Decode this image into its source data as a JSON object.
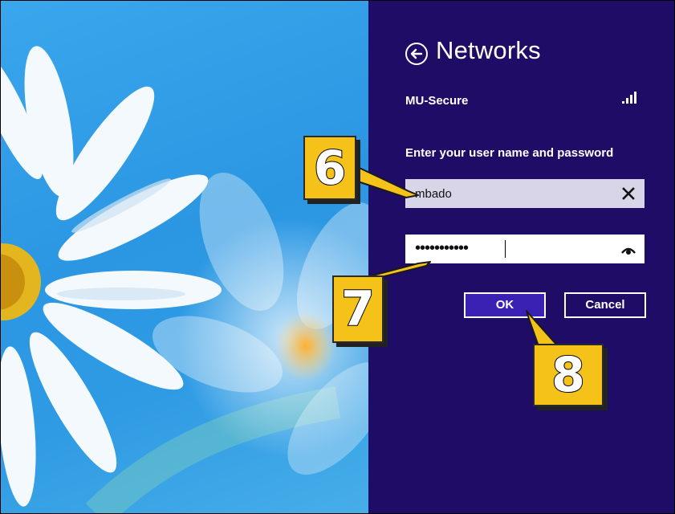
{
  "panel": {
    "title": "Networks",
    "back_icon": "back-arrow-icon",
    "network_name": "MU-Secure",
    "signal_icon": "wifi-signal-icon",
    "prompt": "Enter your user name and password",
    "username": {
      "value": "mbado",
      "clear_icon": "close-icon"
    },
    "password": {
      "value": "•••••••••••",
      "reveal_icon": "eye-icon"
    },
    "ok_label": "OK",
    "cancel_label": "Cancel"
  },
  "callouts": {
    "step6": "6",
    "step7": "7",
    "step8": "8"
  },
  "colors": {
    "panel_bg": "#1f0c66",
    "ok_bg": "#3a20b3",
    "callout_bg": "#f5c21a",
    "wallpaper": "#2b97e3"
  }
}
